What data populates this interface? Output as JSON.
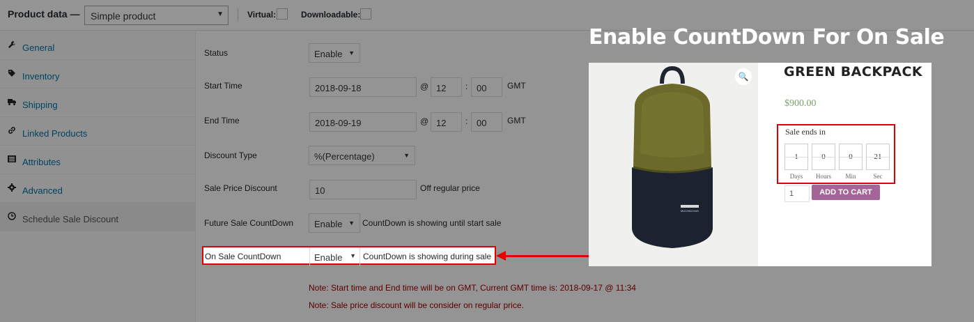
{
  "header": {
    "title": "Product data —",
    "product_type": "Simple product",
    "virtual_label": "Virtual:",
    "downloadable_label": "Downloadable:"
  },
  "tabs": [
    {
      "label": "General",
      "icon": "wrench-icon"
    },
    {
      "label": "Inventory",
      "icon": "tag-icon"
    },
    {
      "label": "Shipping",
      "icon": "truck-icon"
    },
    {
      "label": "Linked Products",
      "icon": "link-icon"
    },
    {
      "label": "Attributes",
      "icon": "list-icon"
    },
    {
      "label": "Advanced",
      "icon": "gear-icon"
    },
    {
      "label": "Schedule Sale Discount",
      "icon": "clock-icon"
    }
  ],
  "form": {
    "status_label": "Status",
    "status_value": "Enable",
    "start_label": "Start Time",
    "start_date": "2018-09-18",
    "start_hour": "12",
    "start_min": "00",
    "end_label": "End Time",
    "end_date": "2018-09-19",
    "end_hour": "12",
    "end_min": "00",
    "at": "@",
    "colon": ":",
    "gmt": "GMT",
    "discount_type_label": "Discount Type",
    "discount_type_value": "%(Percentage)",
    "sale_discount_label": "Sale Price Discount",
    "sale_discount_value": "10",
    "sale_discount_suffix": "Off regular price",
    "future_label": "Future Sale CountDown",
    "future_value": "Enable",
    "future_desc": "CountDown is showing until start sale",
    "onsale_label": "On Sale CountDown",
    "onsale_value": "Enable",
    "onsale_desc": "CountDown is showing during sale",
    "note1": "Note: Start time and End time will be on GMT, Current GMT time is: 2018-09-17 @ 11:34",
    "note2": "Note: Sale price discount will be consider on regular price."
  },
  "callout": {
    "title": "Enable CountDown For On Sale"
  },
  "preview": {
    "product_title": "GREEN BACKPACK",
    "price": "$900.00",
    "sale_ends_label": "Sale ends in",
    "countdown": [
      {
        "value": "1",
        "unit": "Days"
      },
      {
        "value": "0",
        "unit": "Hours"
      },
      {
        "value": "0",
        "unit": "Min"
      },
      {
        "value": "21",
        "unit": "Sec"
      }
    ],
    "qty": "1",
    "add_to_cart": "ADD TO CART",
    "bag_brand": "MUCHACHAS"
  },
  "colors": {
    "highlight": "#e00000",
    "price": "#77a464",
    "button": "#a46497",
    "bag_olive": "#6b6a2a",
    "bag_navy": "#1d2230"
  }
}
